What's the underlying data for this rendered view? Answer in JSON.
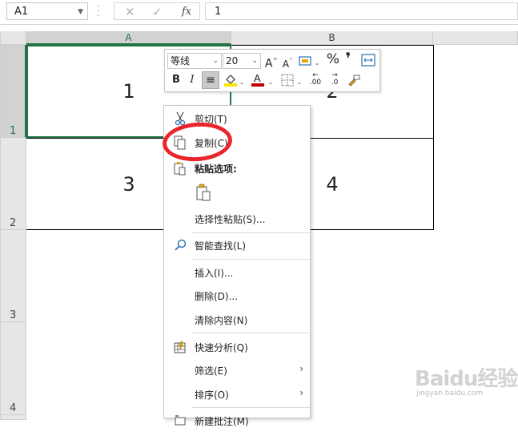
{
  "formula_bar": {
    "name_box": "A1",
    "cancel_icon": "✕",
    "enter_icon": "✓",
    "fx_label": "fx",
    "content": "1"
  },
  "columns": [
    "A",
    "B"
  ],
  "rows": [
    "1",
    "2",
    "3",
    "4"
  ],
  "cells": {
    "A1": "1",
    "B1": "2",
    "A2": "3",
    "B2": "4"
  },
  "mini_toolbar": {
    "font_name": "等线",
    "font_size": "20",
    "grow_font": "A",
    "shrink_font": "A",
    "percent": "%",
    "comma": "❜",
    "bold": "B",
    "italic": "I",
    "font_color_glyph": "A",
    "inc_decimal": ".00",
    "dec_decimal": ".0",
    "highlight_color": "#f5e500",
    "font_color": "#c00000"
  },
  "context_menu": {
    "items": [
      {
        "label": "剪切(T)"
      },
      {
        "label": "复制(C)"
      },
      {
        "label": "粘贴选项:"
      },
      {
        "label": "选择性粘贴(S)..."
      },
      {
        "label": "智能查找(L)"
      },
      {
        "label": "插入(I)..."
      },
      {
        "label": "删除(D)..."
      },
      {
        "label": "清除内容(N)"
      },
      {
        "label": "快速分析(Q)"
      },
      {
        "label": "筛选(E)"
      },
      {
        "label": "排序(O)"
      },
      {
        "label": "新建批注(M)"
      }
    ]
  },
  "watermark": {
    "brand": "Baidu经验",
    "url": "jingyan.baidu.com"
  },
  "colors": {
    "accent": "#217346",
    "highlight": "#e8262c"
  }
}
